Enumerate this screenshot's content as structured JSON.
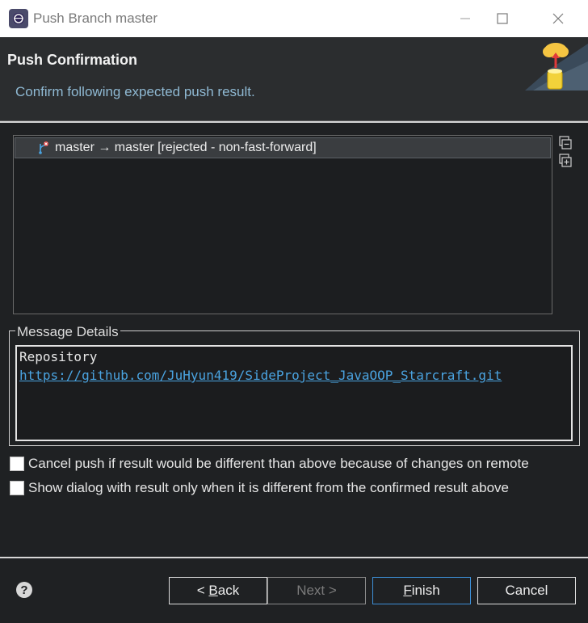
{
  "window": {
    "title": "Push Branch master"
  },
  "header": {
    "title": "Push Confirmation",
    "subtitle": "Confirm following expected push result."
  },
  "results": [
    {
      "text": "master → master [rejected - non-fast-forward]",
      "icon": "branch-rejected-icon"
    }
  ],
  "side_tools": [
    {
      "icon": "collapse-all-icon"
    },
    {
      "icon": "expand-all-icon"
    }
  ],
  "details": {
    "group_label": "Message Details",
    "repo_label": "Repository",
    "repo_url": "https://github.com/JuHyun419/SideProject_JavaOOP_Starcraft.git"
  },
  "options": {
    "cancel_push_label": "Cancel push if result would be different than above because of changes on remote",
    "cancel_push_checked": false,
    "show_dialog_label": "Show dialog with result only when it is different from the confirmed result above",
    "show_dialog_checked": false
  },
  "buttons": {
    "back_prefix": "< ",
    "back_mnemonic": "B",
    "back_rest": "ack",
    "next": "Next >",
    "finish_mnemonic": "F",
    "finish_rest": "inish",
    "cancel": "Cancel"
  },
  "help": {
    "glyph": "?"
  },
  "colors": {
    "background": "#1f2123",
    "banner": "#2b2d2f",
    "link": "#4aa3e0",
    "subtitle": "#8fb9d3",
    "primary_border": "#3d8fd6"
  }
}
